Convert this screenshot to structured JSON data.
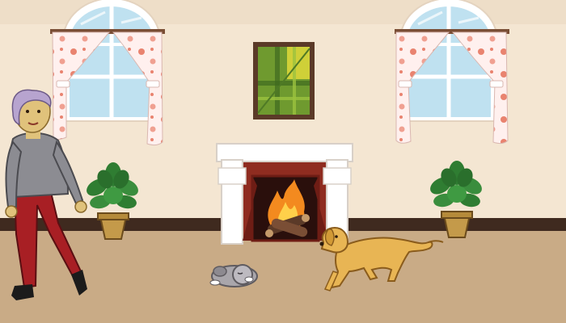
{
  "scene": {
    "colors": {
      "wall": "#f4e6d2",
      "wall_shade": "#ead9c2",
      "floor": "#c9ab86",
      "baseboard": "#3f2a1f",
      "window_frame": "#ffffff",
      "sky": "#bfe1f0",
      "curtain": "#fff0ee",
      "flower": "#e9836f",
      "painting_frame": "#5b3a28",
      "painting_bg": "#6f9a2f",
      "mantel": "#ffffff",
      "brick": "#8f2c20",
      "fire": "#f38a1f",
      "pot": "#c49a4a",
      "leaf": "#2f7d32",
      "dog": "#e8b554",
      "puppy": "#a9a6ab",
      "hair": "#b7a4cf",
      "skin": "#e0c27b",
      "sweater": "#8c8c92",
      "pants": "#a81f24"
    },
    "icons": {
      "window_left": "arched-window-icon",
      "window_right": "arched-window-icon",
      "painting": "painting-icon",
      "fireplace": "fireplace-icon",
      "plant": "potted-plant-icon",
      "dog": "dog-icon",
      "puppy": "sleeping-puppy-icon",
      "person": "elderly-woman-icon"
    }
  }
}
